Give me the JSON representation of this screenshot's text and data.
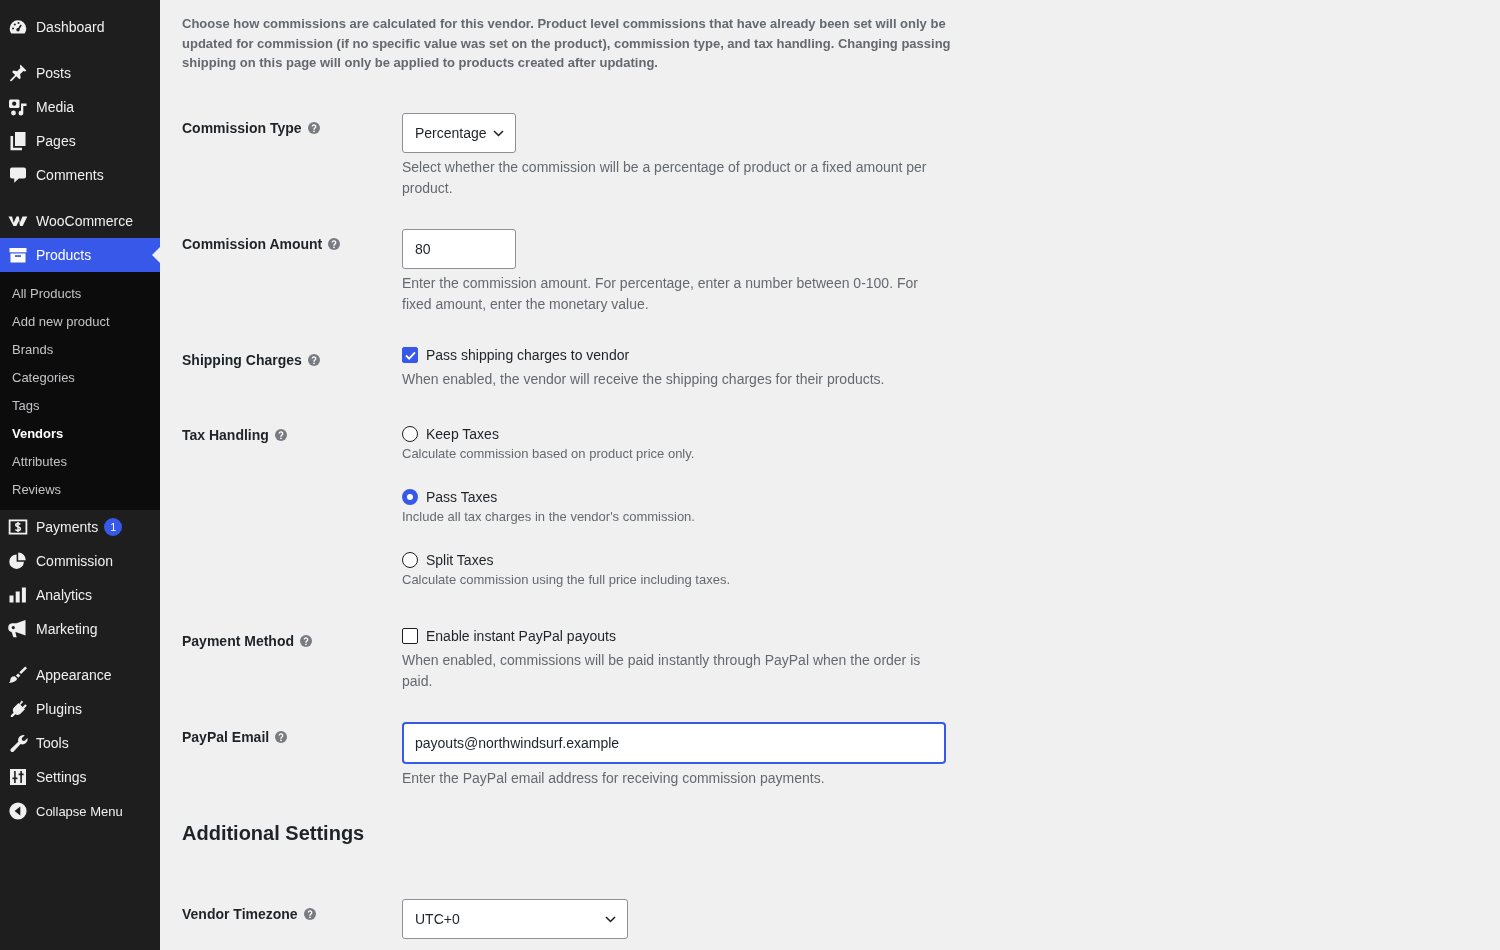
{
  "sidebar": {
    "sections": [
      {
        "items": [
          {
            "kind": "menu",
            "label": "Dashboard",
            "selected": false
          }
        ]
      },
      {
        "items": [
          {
            "kind": "menu",
            "label": "Posts",
            "selected": false
          },
          {
            "kind": "menu",
            "label": "Media",
            "selected": false
          },
          {
            "kind": "menu",
            "label": "Pages",
            "selected": false
          },
          {
            "kind": "menu",
            "label": "Comments",
            "selected": false
          }
        ]
      },
      {
        "items": [
          {
            "kind": "menu",
            "label": "WooCommerce",
            "selected": false
          },
          {
            "kind": "menu",
            "label": "Products",
            "selected": true,
            "children": [
              {
                "label": "All Products",
                "selected": false
              },
              {
                "label": "Add new product",
                "selected": false
              },
              {
                "label": "Brands",
                "selected": false
              },
              {
                "label": "Categories",
                "selected": false
              },
              {
                "label": "Tags",
                "selected": false
              },
              {
                "label": "Vendors",
                "selected": true
              },
              {
                "label": "Attributes",
                "selected": false
              },
              {
                "label": "Reviews",
                "selected": false
              }
            ]
          },
          {
            "kind": "menu",
            "label": "Payments",
            "selected": false,
            "badge": "1"
          },
          {
            "kind": "menu",
            "label": "Commission",
            "selected": false
          },
          {
            "kind": "menu",
            "label": "Analytics",
            "selected": false
          },
          {
            "kind": "menu",
            "label": "Marketing",
            "selected": false
          }
        ]
      },
      {
        "items": [
          {
            "kind": "menu",
            "label": "Appearance",
            "selected": false
          },
          {
            "kind": "menu",
            "label": "Plugins",
            "selected": false
          },
          {
            "kind": "menu",
            "label": "Tools",
            "selected": false
          },
          {
            "kind": "menu",
            "label": "Settings",
            "selected": false
          },
          {
            "kind": "collapse",
            "label": "Collapse Menu",
            "selected": false
          }
        ]
      }
    ]
  },
  "intro": "Choose how commissions are calculated for this vendor. Product level commissions that have already been set will only be updated for commission (if no specific value was set on the product), commission type, and tax handling. Changing passing shipping on this page will only be applied to products created after updating.",
  "fields": [
    {
      "kind": "select",
      "label": "Commission Type",
      "value": "Percentage",
      "focused": false,
      "description": "Select whether the commission will be a percentage of product or a fixed amount per product."
    },
    {
      "kind": "text",
      "label": "Commission Amount",
      "value": "80",
      "focused": false,
      "description": "Enter the commission amount. For percentage, enter a number between 0-100. For fixed amount, enter the monetary value."
    },
    {
      "kind": "checkbox",
      "label": "Shipping Charges",
      "option": "Pass shipping charges to vendor",
      "checked": true,
      "description": "When enabled, the vendor will receive the shipping charges for their products."
    },
    {
      "kind": "radio",
      "label": "Tax Handling",
      "options": [
        {
          "label": "Keep Taxes",
          "description": "Calculate commission based on product price only.",
          "selected": false
        },
        {
          "label": "Pass Taxes",
          "description": "Include all tax charges in the vendor's commission.",
          "selected": true
        },
        {
          "label": "Split Taxes",
          "description": "Calculate commission using the full price including taxes.",
          "selected": false
        }
      ]
    },
    {
      "kind": "checkbox",
      "label": "Payment Method",
      "option": "Enable instant PayPal payouts",
      "checked": false,
      "description": "When enabled, commissions will be paid instantly through PayPal when the order is paid."
    },
    {
      "kind": "text",
      "label": "PayPal Email",
      "value": "payouts@northwindsurf.example",
      "focused": true,
      "description": "Enter the PayPal email address for receiving commission payments."
    }
  ],
  "additional_settings": {
    "heading": "Additional Settings",
    "fields": [
      {
        "kind": "select",
        "label": "Vendor Timezone",
        "value": "UTC+0",
        "focused": false
      }
    ]
  }
}
